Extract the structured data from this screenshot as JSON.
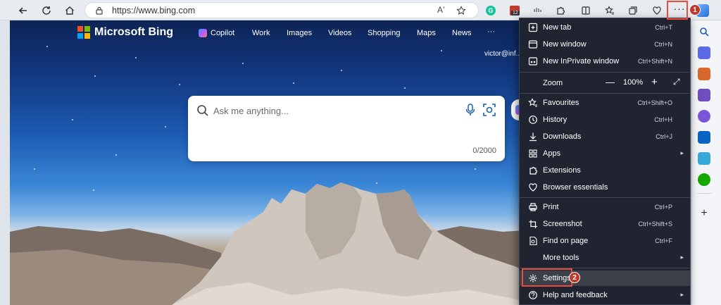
{
  "browser": {
    "url": "https://www.bing.com",
    "ext_badge": "12"
  },
  "page": {
    "brand": "Microsoft Bing",
    "nav": [
      "Copilot",
      "Work",
      "Images",
      "Videos",
      "Shopping",
      "Maps",
      "News",
      "···"
    ],
    "user": "victor@inf...",
    "search_placeholder": "Ask me anything...",
    "char_count": "0/2000"
  },
  "menu": {
    "new_tab": {
      "label": "New tab",
      "shortcut": "Ctrl+T"
    },
    "new_window": {
      "label": "New window",
      "shortcut": "Ctrl+N"
    },
    "inprivate": {
      "label": "New InPrivate window",
      "shortcut": "Ctrl+Shift+N"
    },
    "zoom": {
      "label": "Zoom",
      "value": "100%",
      "minus": "—",
      "plus": "+",
      "full": "⤢"
    },
    "favourites": {
      "label": "Favourites",
      "shortcut": "Ctrl+Shift+O"
    },
    "history": {
      "label": "History",
      "shortcut": "Ctrl+H"
    },
    "downloads": {
      "label": "Downloads",
      "shortcut": "Ctrl+J"
    },
    "apps": {
      "label": "Apps",
      "arrow": "▸"
    },
    "extensions": {
      "label": "Extensions"
    },
    "essentials": {
      "label": "Browser essentials"
    },
    "print": {
      "label": "Print",
      "shortcut": "Ctrl+P"
    },
    "screenshot": {
      "label": "Screenshot",
      "shortcut": "Ctrl+Shift+S"
    },
    "find": {
      "label": "Find on page",
      "shortcut": "Ctrl+F"
    },
    "more_tools": {
      "label": "More tools",
      "arrow": "▸"
    },
    "settings": {
      "label": "Settings"
    },
    "help": {
      "label": "Help and feedback",
      "arrow": "▸"
    }
  },
  "annotations": {
    "step1": "1",
    "step2": "2"
  },
  "colors": {
    "menu_bg": "#1f2430",
    "highlight": "#e74c3c",
    "badge": "#c0392b"
  }
}
